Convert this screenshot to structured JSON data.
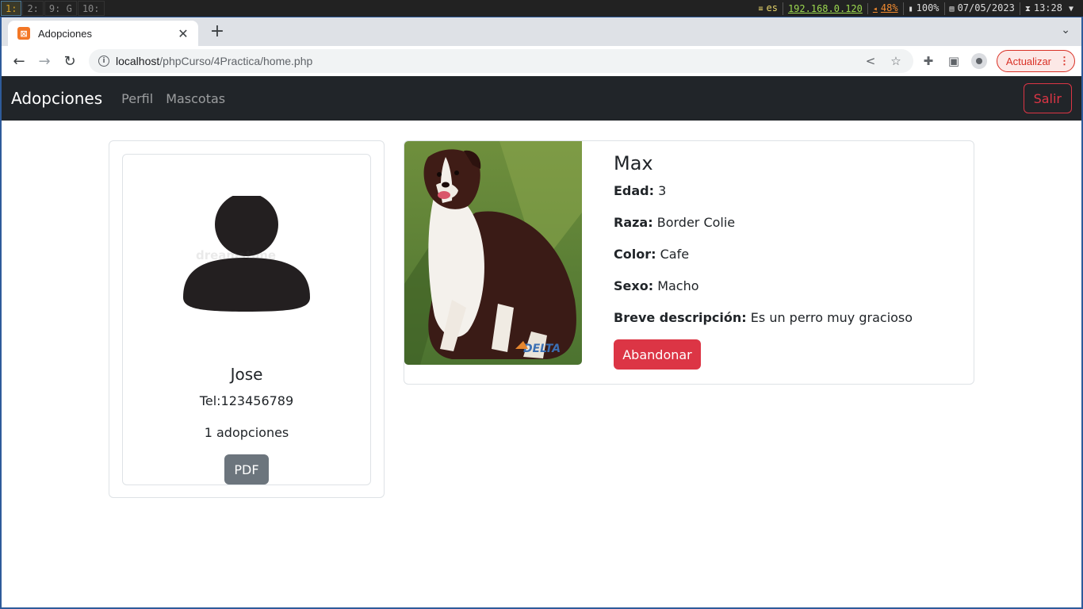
{
  "statusbar": {
    "workspaces": [
      {
        "label": "1: ",
        "active": true
      },
      {
        "label": "2: ",
        "active": false
      },
      {
        "label": "9: G",
        "active": false
      },
      {
        "label": "10: ",
        "active": false
      }
    ],
    "keyboard": "es",
    "ip": "192.168.0.120",
    "volume": "48%",
    "battery": "100%",
    "date": "07/05/2023",
    "time": "13:28"
  },
  "browser": {
    "tab_title": "Adopciones",
    "url_host": "localhost",
    "url_path": "/phpCurso/4Practica/home.php",
    "update_label": "Actualizar"
  },
  "navbar": {
    "brand": "Adopciones",
    "links": [
      "Perfil",
      "Mascotas"
    ],
    "logout": "Salir"
  },
  "profile": {
    "name": "Jose",
    "tel": "Tel:123456789",
    "adoptions": "1 adopciones",
    "pdf_button": "PDF",
    "watermark": "dreamstime"
  },
  "pet": {
    "name": "Max",
    "fields": [
      {
        "label": "Edad:",
        "value": "3"
      },
      {
        "label": "Raza:",
        "value": "Border Colie"
      },
      {
        "label": "Color:",
        "value": "Cafe"
      },
      {
        "label": "Sexo:",
        "value": "Macho"
      },
      {
        "label": "Breve descripción:",
        "value": "Es un perro muy gracioso"
      }
    ],
    "action_button": "Abandonar",
    "photo_logo": "DELTA"
  },
  "colors": {
    "navbar_bg": "#212529",
    "danger": "#dc3545",
    "secondary": "#6c757d"
  }
}
